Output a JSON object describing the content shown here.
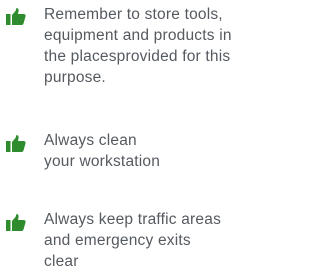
{
  "icon": {
    "name": "thumbs-up-icon",
    "color": "#2e8b2e"
  },
  "items": [
    {
      "text": "Remember to store tools,\nequipment and products in\nthe placesprovided for this\npurpose."
    },
    {
      "text": "Always clean\nyour workstation"
    },
    {
      "text": "Always keep traffic areas\nand emergency exits\nclear"
    }
  ]
}
